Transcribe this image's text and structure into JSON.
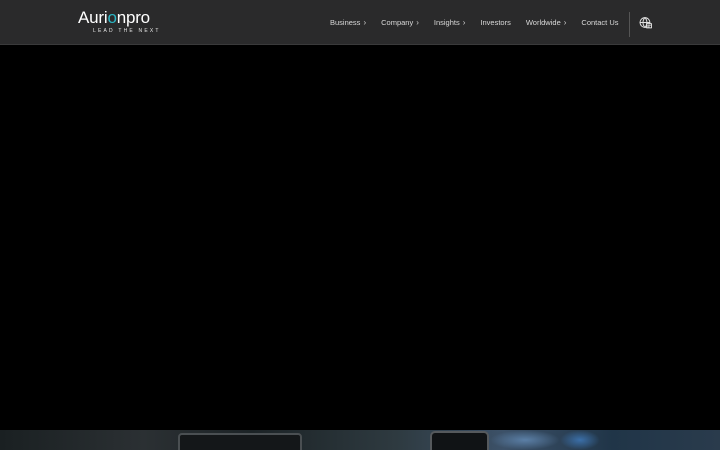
{
  "brand": {
    "name_part1": "Auri",
    "name_accent": "o",
    "name_part2": "npro",
    "tagline": "LEAD THE NEXT"
  },
  "nav": {
    "items": [
      {
        "label": "Business",
        "has_submenu": true
      },
      {
        "label": "Company",
        "has_submenu": true
      },
      {
        "label": "Insights",
        "has_submenu": true
      },
      {
        "label": "Investors",
        "has_submenu": false
      },
      {
        "label": "Worldwide",
        "has_submenu": true
      },
      {
        "label": "Contact Us",
        "has_submenu": false
      }
    ],
    "submenu_glyph": "›",
    "globe_icon": "globe-icon"
  },
  "colors": {
    "header_bg": "#2a2a2b",
    "page_bg": "#000000",
    "brand_accent": "#2bb7c5"
  }
}
